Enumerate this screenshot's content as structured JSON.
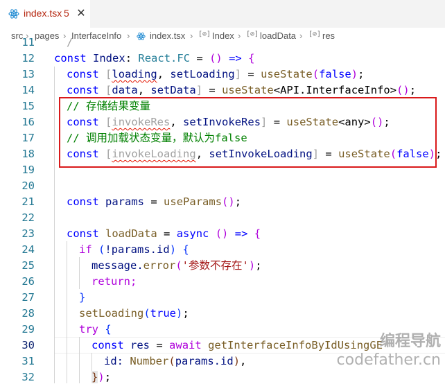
{
  "tab": {
    "file_name": "index.tsx",
    "problem_count": "5",
    "close_glyph": "✕",
    "icon": "react-icon"
  },
  "breadcrumb": {
    "parts": [
      "src",
      "pages",
      "InterfaceInfo",
      "index.tsx",
      "Index",
      "loadData",
      "res"
    ],
    "separator": "›",
    "symbol_glyph": "[⊘]"
  },
  "editor": {
    "line_numbers": [
      "11",
      "12",
      "13",
      "14",
      "15",
      "16",
      "17",
      "18",
      "19",
      "20",
      "21",
      "22",
      "23",
      "24",
      "25",
      "26",
      "27",
      "28",
      "29",
      "30",
      "31",
      "32"
    ],
    "active_line": "30"
  },
  "code": {
    "l11": "/",
    "l12_kw": "const",
    "l12_name": "Index",
    "l12_colon": ":",
    "l12_type": "React.FC",
    "l12_eq": "=",
    "l12_paren": "()",
    "l12_arrow": "=>",
    "l12_brace": "{",
    "l13_kw": "const",
    "l13_b1": "[",
    "l13_v1": "loading",
    "l13_comma": ",",
    "l13_v2": "setLoading",
    "l13_b2": "]",
    "l13_eq": "=",
    "l13_fn": "useState",
    "l13_p1": "(",
    "l13_arg": "false",
    "l13_p2": ")",
    "l13_semi": ";",
    "l14_kw": "const",
    "l14_b1": "[",
    "l14_v1": "data",
    "l14_comma": ",",
    "l14_v2": "setData",
    "l14_b2": "]",
    "l14_eq": "=",
    "l14_fn": "useState",
    "l14_gen": "<API.InterfaceInfo>",
    "l14_call": "()",
    "l14_semi": ";",
    "l15": "// 存储结果变量",
    "l16_kw": "const",
    "l16_b1": "[",
    "l16_v1": "invokeRes",
    "l16_comma": ",",
    "l16_v2": "setInvokeRes",
    "l16_b2": "]",
    "l16_eq": "=",
    "l16_fn": "useState",
    "l16_gen": "<any>",
    "l16_call": "()",
    "l16_semi": ";",
    "l17": "// 调用加载状态变量，默认为false",
    "l18_kw": "const",
    "l18_b1": "[",
    "l18_v1": "invokeLoading",
    "l18_comma": ",",
    "l18_v2": "setInvokeLoading",
    "l18_b2": "]",
    "l18_eq": "=",
    "l18_fn": "useState",
    "l18_p1": "(",
    "l18_arg": "false",
    "l18_p2": ")",
    "l18_semi": ";",
    "l21_kw": "const",
    "l21_name": "params",
    "l21_eq": "=",
    "l21_fn": "useParams",
    "l21_call": "()",
    "l21_semi": ";",
    "l23_kw": "const",
    "l23_name": "loadData",
    "l23_eq": "=",
    "l23_async": "async",
    "l23_paren": "()",
    "l23_arrow": "=>",
    "l23_brace": "{",
    "l24_kw": "if",
    "l24_p1": "(",
    "l24_expr": "!params.id",
    "l24_p2": ")",
    "l24_brace": "{",
    "l25_obj": "message.",
    "l25_fn": "error",
    "l25_p1": "(",
    "l25_str": "'参数不存在'",
    "l25_p2": ")",
    "l25_semi": ";",
    "l26": "return;",
    "l27": "}",
    "l28_fn": "setLoading",
    "l28_p1": "(",
    "l28_arg": "true",
    "l28_p2": ")",
    "l28_semi": ";",
    "l29_kw": "try",
    "l29_brace": "{",
    "l30_kw": "const",
    "l30_name": "res",
    "l30_eq": "=",
    "l30_await": "await",
    "l30_fn": "getInterfaceInfoByIdUsingGE",
    "l31_prop": "id:",
    "l31_fn": "Number",
    "l31_p1": "(",
    "l31_arg": "params.id",
    "l31_p2": ")",
    "l31_comma": ",",
    "l32_brace": "}",
    "l32_paren": ")",
    "l32_semi": ";"
  },
  "watermark": {
    "line1": "编程导航",
    "line2": "codefather.cn"
  },
  "colors": {
    "keyword": "#0000ff",
    "function": "#795e26",
    "variable": "#001080",
    "comment": "#008000",
    "string": "#a31515",
    "highlight_border": "#d9191a"
  }
}
